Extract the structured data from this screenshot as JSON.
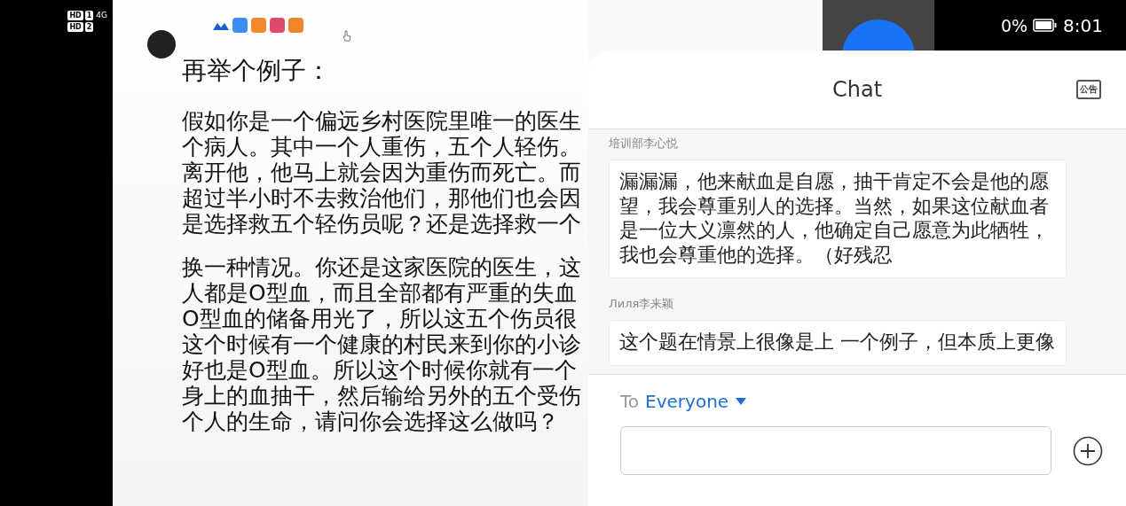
{
  "status_bar": {
    "sim": [
      {
        "label": "HD",
        "slot": "1"
      },
      {
        "label": "HD",
        "slot": "2"
      }
    ],
    "network": "4G",
    "battery": "0%",
    "time": "8:01"
  },
  "slide": {
    "title": "再举个例子：",
    "paragraphs": [
      [
        "假如你是一个偏远乡村医院里唯一的医生",
        "个病人。其中一个人重伤，五个人轻伤。",
        "离开他，他马上就会因为重伤而死亡。而",
        "超过半小时不去救治他们，那他们也会因",
        "是选择救五个轻伤员呢？还是选择救一个"
      ],
      [
        "换一种情况。你还是这家医院的医生，这",
        "人都是O型血，而且全部都有严重的失血",
        "O型血的储备用光了，所以这五个伤员很",
        "这个时候有一个健康的村民来到你的小诊",
        "好也是O型血。所以这个时候你就有一个",
        "身上的血抽干，然后输给另外的五个受伤",
        "个人的生命，请问你会选择这么做吗？"
      ]
    ]
  },
  "chat": {
    "title": "Chat",
    "notice_label": "公告",
    "messages": [
      {
        "sender": "培训部李心悦",
        "text": "漏漏漏，他来献血是自愿，抽干肯定不会是他的愿望，我会尊重别人的选择。当然，如果这位献血者是一位大义凛然的人，他确定自己愿意为此牺牲，我也会尊重他的选择。（好残忍"
      },
      {
        "sender": "Лиля李来颖",
        "text": "这个题在情景上很像是上 一个例子，但本质上更像"
      }
    ],
    "to_label": "To",
    "recipient": "Everyone"
  }
}
